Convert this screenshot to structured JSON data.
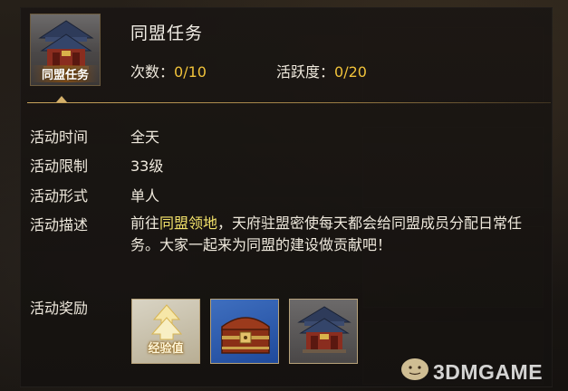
{
  "task": {
    "icon_label": "同盟任务",
    "title": "同盟任务",
    "count_label": "次数：",
    "count_value": "0/10",
    "activity_label": "活跃度：",
    "activity_value": "0/20"
  },
  "details": {
    "time_label": "活动时间",
    "time_value": "全天",
    "limit_label": "活动限制",
    "limit_value": "33级",
    "form_label": "活动形式",
    "form_value": "单人",
    "desc_label": "活动描述",
    "desc_pre": "前往",
    "desc_highlight": "同盟领地",
    "desc_post": "，天府驻盟密使每天都会给同盟成员分配日常任务。大家一起来为同盟的建设做贡献吧！",
    "reward_label": "活动奖励"
  },
  "rewards": [
    {
      "name": "exp",
      "label": "经验值",
      "icon": "exp-arrow-icon"
    },
    {
      "name": "chest",
      "icon": "treasure-chest-icon"
    },
    {
      "name": "building",
      "icon": "alliance-hall-icon"
    }
  ],
  "watermark": {
    "text": "3DMGAME"
  },
  "colors": {
    "accent_gold": "#f0c23a",
    "highlight_yellow": "#f3e26b",
    "divider_gold": "#c9a45c",
    "text": "#efe9dd"
  }
}
